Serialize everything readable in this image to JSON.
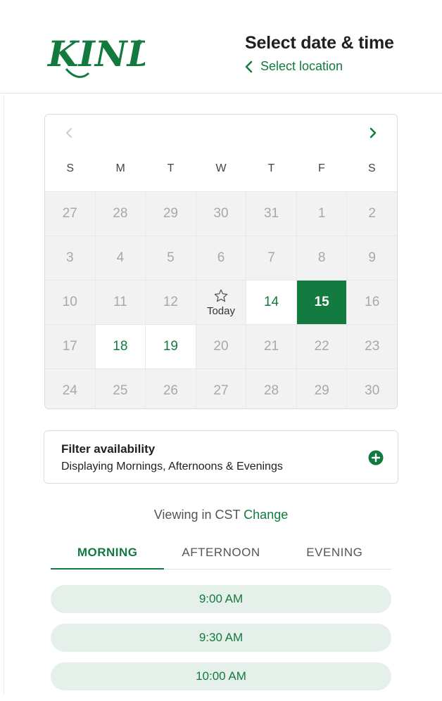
{
  "brand": {
    "logo_text": "KIND",
    "color": "#127a3f"
  },
  "header": {
    "title": "Select date & time",
    "back_label": "Select location"
  },
  "calendar": {
    "weekdays": [
      "S",
      "M",
      "T",
      "W",
      "T",
      "F",
      "S"
    ],
    "days": [
      {
        "label": "27",
        "state": "disabled"
      },
      {
        "label": "28",
        "state": "disabled"
      },
      {
        "label": "29",
        "state": "disabled"
      },
      {
        "label": "30",
        "state": "disabled"
      },
      {
        "label": "31",
        "state": "disabled"
      },
      {
        "label": "1",
        "state": "disabled"
      },
      {
        "label": "2",
        "state": "disabled"
      },
      {
        "label": "3",
        "state": "disabled"
      },
      {
        "label": "4",
        "state": "disabled"
      },
      {
        "label": "5",
        "state": "disabled"
      },
      {
        "label": "6",
        "state": "disabled"
      },
      {
        "label": "7",
        "state": "disabled"
      },
      {
        "label": "8",
        "state": "disabled"
      },
      {
        "label": "9",
        "state": "disabled"
      },
      {
        "label": "10",
        "state": "disabled"
      },
      {
        "label": "11",
        "state": "disabled"
      },
      {
        "label": "12",
        "state": "disabled"
      },
      {
        "label": "Today",
        "state": "today"
      },
      {
        "label": "14",
        "state": "available"
      },
      {
        "label": "15",
        "state": "selected"
      },
      {
        "label": "16",
        "state": "disabled"
      },
      {
        "label": "17",
        "state": "disabled"
      },
      {
        "label": "18",
        "state": "available"
      },
      {
        "label": "19",
        "state": "available"
      },
      {
        "label": "20",
        "state": "disabled"
      },
      {
        "label": "21",
        "state": "disabled"
      },
      {
        "label": "22",
        "state": "disabled"
      },
      {
        "label": "23",
        "state": "disabled"
      },
      {
        "label": "24",
        "state": "disabled"
      },
      {
        "label": "25",
        "state": "disabled"
      },
      {
        "label": "26",
        "state": "disabled"
      },
      {
        "label": "27",
        "state": "disabled"
      },
      {
        "label": "28",
        "state": "disabled"
      },
      {
        "label": "29",
        "state": "disabled"
      },
      {
        "label": "30",
        "state": "disabled"
      }
    ]
  },
  "filter": {
    "title": "Filter availability",
    "description": "Displaying Mornings, Afternoons & Evenings"
  },
  "timezone": {
    "prefix": "Viewing in CST",
    "change_label": "Change"
  },
  "tabs": [
    {
      "label": "MORNING",
      "active": true
    },
    {
      "label": "AFTERNOON",
      "active": false
    },
    {
      "label": "EVENING",
      "active": false
    }
  ],
  "slots": [
    "9:00 AM",
    "9:30 AM",
    "10:00 AM"
  ]
}
